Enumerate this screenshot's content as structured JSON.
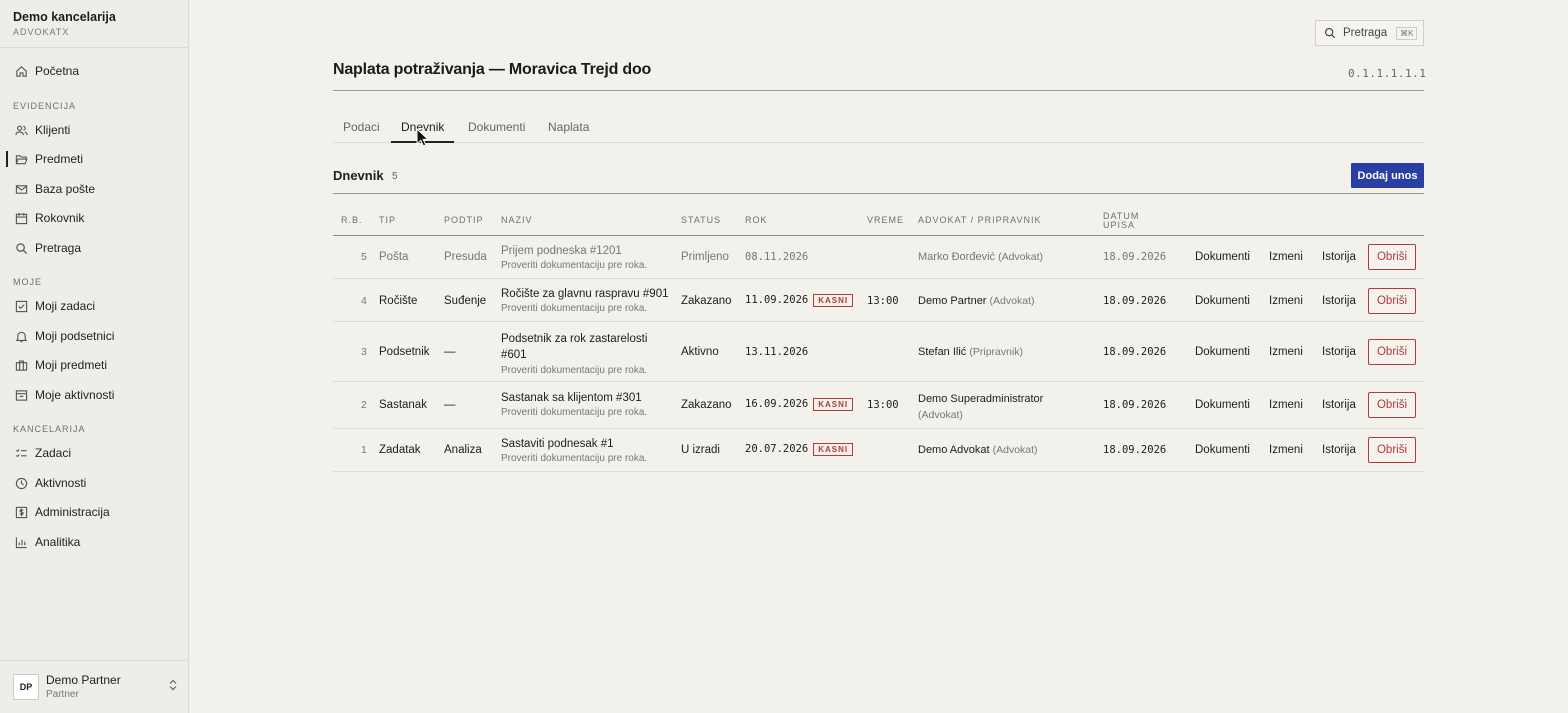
{
  "brand": {
    "name": "Demo kancelarija",
    "sub": "ADVOKATX"
  },
  "nav": {
    "home": "Početna",
    "section_evidencija": "EVIDENCIJA",
    "klijenti": "Klijenti",
    "predmeti": "Predmeti",
    "baza_poste": "Baza pošte",
    "rokovnik": "Rokovnik",
    "pretraga": "Pretraga",
    "section_moje": "MOJE",
    "moji_zadaci": "Moji zadaci",
    "moji_podsetnici": "Moji podsetnici",
    "moji_predmeti": "Moji predmeti",
    "moje_aktivnosti": "Moje aktivnosti",
    "section_kancelarija": "KANCELARIJA",
    "zadaci": "Zadaci",
    "aktivnosti": "Aktivnosti",
    "administracija": "Administracija",
    "analitika": "Analitika"
  },
  "user": {
    "initials": "DP",
    "name": "Demo Partner",
    "role": "Partner"
  },
  "search": {
    "placeholder": "Pretraga",
    "shortcut": "⌘K"
  },
  "page": {
    "title": "Naplata potraživanja — Moravica Trejd doo",
    "version": "0.1.1.1.1.1"
  },
  "tabs": [
    "Podaci",
    "Dnevnik",
    "Dokumenti",
    "Naplata"
  ],
  "section": {
    "title": "Dnevnik",
    "count": "5",
    "add_label": "Dodaj unos"
  },
  "table": {
    "headers": {
      "rb": "R.B.",
      "tip": "TIP",
      "podtip": "PODTIP",
      "naziv": "NAZIV",
      "status": "STATUS",
      "rok": "ROK",
      "vreme": "VREME",
      "advokat": "ADVOKAT / PRIPRAVNIK",
      "datum1": "DATUM",
      "datum2": "UPISA"
    },
    "actions": {
      "dokumenti": "Dokumenti",
      "izmeni": "Izmeni",
      "istorija": "Istorija",
      "obrisi": "Obriši"
    },
    "rows": [
      {
        "rb": "5",
        "tip": "Pošta",
        "podtip": "Presuda",
        "naziv": "Prijem podneska #1201",
        "naziv2": "",
        "opis": "Proveriti dokumentaciju pre roka.",
        "status": "Primljeno",
        "rok": "08.11.2026",
        "kasni": "",
        "vreme": "",
        "advokat": "Marko Đorđević",
        "uloga": "(Advokat)",
        "datum": "18.09.2026"
      },
      {
        "rb": "4",
        "tip": "Ročište",
        "podtip": "Suđenje",
        "naziv": "Ročište za glavnu raspravu #901",
        "naziv2": "",
        "opis": "Proveriti dokumentaciju pre roka.",
        "status": "Zakazano",
        "rok": "11.09.2026",
        "kasni": "KASNI",
        "vreme": "13:00",
        "advokat": "Demo Partner",
        "uloga": "(Advokat)",
        "datum": "18.09.2026"
      },
      {
        "rb": "3",
        "tip": "Podsetnik",
        "podtip": "—",
        "naziv": "Podsetnik za rok zastarelosti",
        "naziv2": "#601",
        "opis": "Proveriti dokumentaciju pre roka.",
        "status": "Aktivno",
        "rok": "13.11.2026",
        "kasni": "",
        "vreme": "",
        "advokat": "Stefan Ilić",
        "uloga": "(Pripravnik)",
        "datum": "18.09.2026"
      },
      {
        "rb": "2",
        "tip": "Sastanak",
        "podtip": "—",
        "naziv": "Sastanak sa klijentom #301",
        "naziv2": "",
        "opis": "Proveriti dokumentaciju pre roka.",
        "status": "Zakazano",
        "rok": "16.09.2026",
        "kasni": "KASNI",
        "vreme": "13:00",
        "advokat": "Demo Superadministrator",
        "uloga": "(Advokat)",
        "datum": "18.09.2026"
      },
      {
        "rb": "1",
        "tip": "Zadatak",
        "podtip": "Analiza",
        "naziv": "Sastaviti podnesak #1",
        "naziv2": "",
        "opis": "Proveriti dokumentaciju pre roka.",
        "status": "U izradi",
        "rok": "20.07.2026",
        "kasni": "KASNI",
        "vreme": "",
        "advokat": "Demo Advokat",
        "uloga": "(Advokat)",
        "datum": "18.09.2026"
      }
    ]
  }
}
